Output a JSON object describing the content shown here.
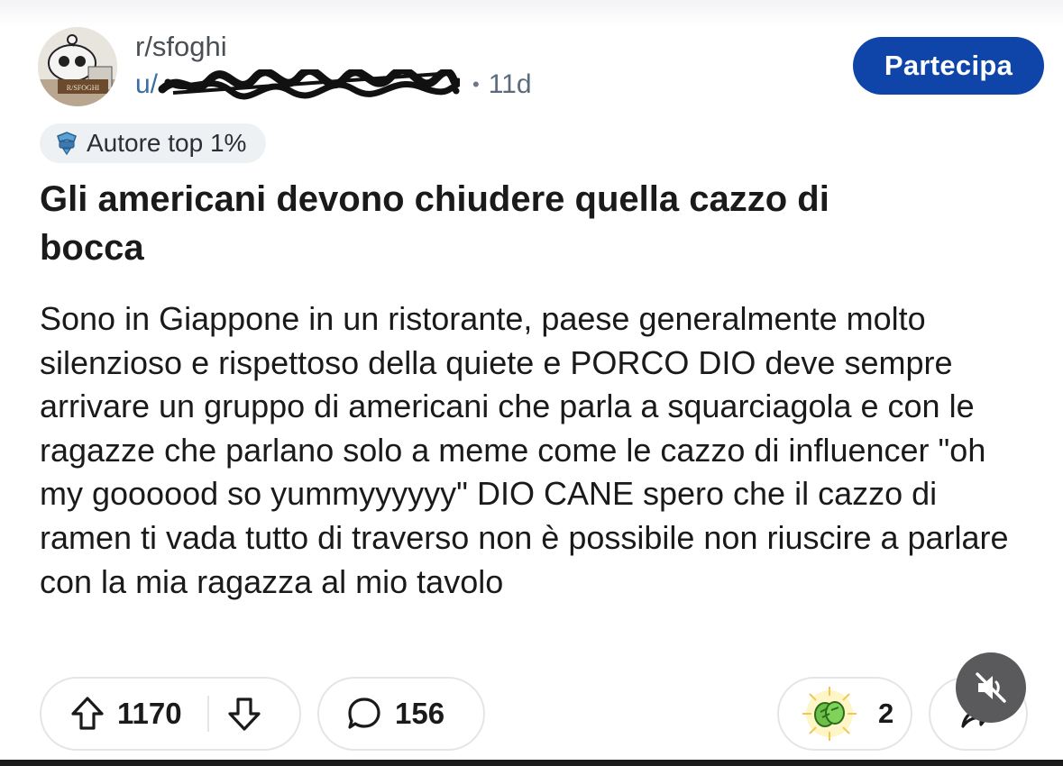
{
  "subreddit": {
    "name": "r/sfoghi",
    "avatar_caption": "R/SFOGHI"
  },
  "post_meta": {
    "username_prefix": "u/",
    "separator": "•",
    "age": "11d"
  },
  "join_button": {
    "label": "Partecipa"
  },
  "flair": {
    "label": "Autore top 1%"
  },
  "post": {
    "title": "Gli americani devono chiudere quella cazzo di bocca",
    "body": "Sono in Giappone in un ristorante, paese generalmente molto silenzioso e rispettoso della quiete e PORCO DIO deve sempre arrivare un gruppo di americani che parla a squarciagola e con le ragazze che parlano solo a meme come le cazzo di influencer \"oh my goooood so yummyyyyyy\" DIO CANE spero che il cazzo di ramen ti vada tutto di traverso non è possibile non riuscire a parlare con la mia ragazza al mio tavolo"
  },
  "actions": {
    "upvotes": "1170",
    "comments": "156",
    "awards": "2"
  },
  "icons": {
    "upvote": "upvote-arrow-icon",
    "downvote": "downvote-arrow-icon",
    "comment": "comment-bubble-icon",
    "award": "award-icon",
    "share": "share-icon",
    "mute": "muted-speaker-icon",
    "flair": "top-author-icon"
  },
  "colors": {
    "join_button": "#0f45a8",
    "username": "#3a6ea5",
    "pill_border": "#e3e6e9"
  }
}
